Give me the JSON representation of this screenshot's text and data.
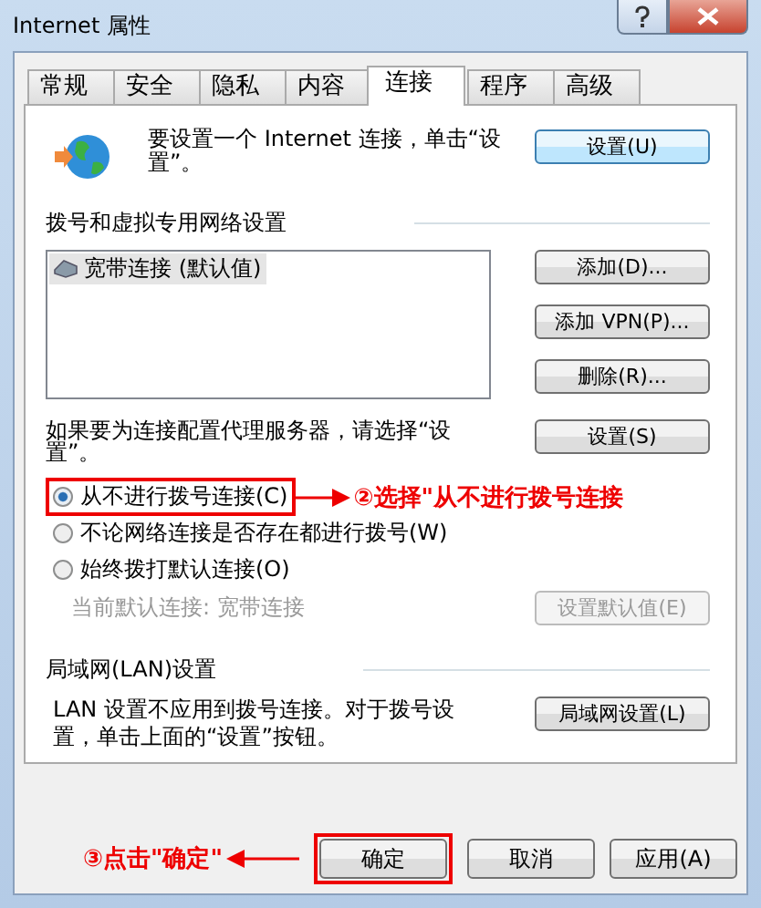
{
  "window": {
    "title": "Internet 属性"
  },
  "tabs": [
    {
      "label": "常规",
      "selected": false
    },
    {
      "label": "安全",
      "selected": false
    },
    {
      "label": "隐私",
      "selected": false
    },
    {
      "label": "内容",
      "selected": false
    },
    {
      "label": "连接",
      "selected": true
    },
    {
      "label": "程序",
      "selected": false
    },
    {
      "label": "高级",
      "selected": false
    }
  ],
  "setup": {
    "text": "要设置一个 Internet 连接，单击“设置”。",
    "button": "设置(U)"
  },
  "dialup": {
    "heading": "拨号和虚拟专用网络设置",
    "connections": [
      {
        "label": "宽带连接 (默认值)",
        "selected": true
      }
    ],
    "buttons": [
      {
        "label": "添加(D)...",
        "disabled": false
      },
      {
        "label": "添加 VPN(P)...",
        "disabled": false
      },
      {
        "label": "删除(R)...",
        "disabled": false
      }
    ],
    "proxy_text": "如果要为连接配置代理服务器，请选择“设置”。",
    "proxy_button": "设置(S)",
    "options": [
      {
        "label": "从不进行拨号连接(C)",
        "selected": true,
        "highlighted": true,
        "annotation": "②选择\"从不进行拨号连接"
      },
      {
        "label": "不论网络连接是否存在都进行拨号(W)",
        "selected": false,
        "highlighted": false
      },
      {
        "label": "始终拨打默认连接(O)",
        "selected": false,
        "highlighted": false
      }
    ],
    "current_default": {
      "text": "当前默认连接: 宽带连接",
      "disabled": true
    },
    "default_button": {
      "label": "设置默认值(E)",
      "disabled": true
    }
  },
  "lan": {
    "heading": "局域网(LAN)设置",
    "text": "LAN 设置不应用到拨号连接。对于拨号设置，单击上面的“设置”按钮。",
    "button": "局域网设置(L)"
  },
  "footer_buttons": [
    {
      "label": "确定",
      "highlighted": true,
      "annotation": "③点击\"确定\""
    },
    {
      "label": "取消",
      "highlighted": false
    },
    {
      "label": "应用(A)",
      "highlighted": false
    }
  ]
}
